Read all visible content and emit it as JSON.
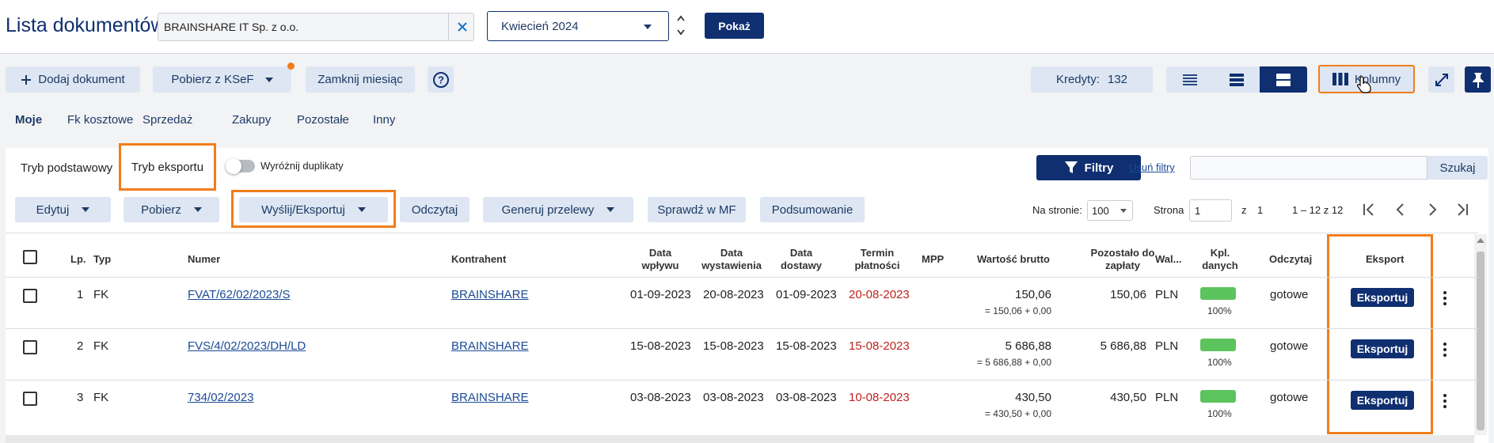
{
  "header": {
    "title": "Lista dokumentów",
    "company": "BRAINSHARE IT Sp. z o.o.",
    "period": "Kwiecień 2024",
    "show_label": "Pokaż"
  },
  "toolbar": {
    "add_document": "Dodaj dokument",
    "ksef": "Pobierz z KSeF",
    "close_month": "Zamknij miesiąc",
    "credits_label": "Kredyty:",
    "credits_value": "132",
    "columns": "Kolumny"
  },
  "tabs": [
    "Moje",
    "Fk kosztowe",
    "Sprzedaż",
    "Zakupy",
    "Pozostałe",
    "Inny"
  ],
  "modes": {
    "basic": "Tryb podstawowy",
    "export": "Tryb eksportu",
    "duplicates": "Wyróżnij duplikaty",
    "filters": "Filtry",
    "clear_filters": "Usuń filtry",
    "search": "Szukaj",
    "search_placeholder": ""
  },
  "actions": {
    "edit": "Edytuj",
    "download": "Pobierz",
    "send": "Wyślij/Eksportuj",
    "read": "Odczytaj",
    "transfers": "Generuj przelewy",
    "mf": "Sprawdź w MF",
    "summary": "Podsumowanie",
    "per_page_label": "Na stronie:",
    "per_page": "100",
    "page_label": "Strona",
    "page": "1",
    "of": "z",
    "total_pages": "1",
    "range": "1 – 12 z 12"
  },
  "columns": {
    "lp": "Lp.",
    "typ": "Typ",
    "numer": "Numer",
    "kontrahent": "Kontrahent",
    "data_wplywu": [
      "Data",
      "wpływu"
    ],
    "data_wyst": [
      "Data",
      "wystawienia"
    ],
    "data_dost": [
      "Data",
      "dostawy"
    ],
    "termin": [
      "Termin",
      "płatności"
    ],
    "mpp": "MPP",
    "brutto": "Wartość brutto",
    "pozostalo": [
      "Pozostało do",
      "zapłaty"
    ],
    "waluta": "Wal...",
    "kpl": [
      "Kpl.",
      "danych"
    ],
    "odczytaj": "Odczytaj",
    "eksport": "Eksport"
  },
  "rows": [
    {
      "lp": "1",
      "typ": "FK",
      "numer": "FVAT/62/02/2023/S",
      "kontrahent": "BRAINSHARE",
      "wplyw": "01-09-2023",
      "wyst": "20-08-2023",
      "dost": "01-09-2023",
      "termin": "20-08-2023",
      "brutto": "150,06",
      "brutto_sub": "= 150,06 + 0,00",
      "pozostalo": "150,06",
      "waluta": "PLN",
      "kpl": 1.0,
      "kpl_label": "100%",
      "odczyt": "gotowe",
      "eksport": "Eksportuj"
    },
    {
      "lp": "2",
      "typ": "FK",
      "numer": "FVS/4/02/2023/DH/LD",
      "kontrahent": "BRAINSHARE",
      "wplyw": "15-08-2023",
      "wyst": "15-08-2023",
      "dost": "15-08-2023",
      "termin": "15-08-2023",
      "brutto": "5 686,88",
      "brutto_sub": "= 5 686,88 + 0,00",
      "pozostalo": "5 686,88",
      "waluta": "PLN",
      "kpl": 1.0,
      "kpl_label": "100%",
      "odczyt": "gotowe",
      "eksport": "Eksportuj"
    },
    {
      "lp": "3",
      "typ": "FK",
      "numer": "734/02/2023",
      "kontrahent": "BRAINSHARE",
      "wplyw": "03-08-2023",
      "wyst": "03-08-2023",
      "dost": "03-08-2023",
      "termin": "10-08-2023",
      "brutto": "430,50",
      "brutto_sub": "= 430,50 + 0,00",
      "pozostalo": "430,50",
      "waluta": "PLN",
      "kpl": 1.0,
      "kpl_label": "100%",
      "odczyt": "gotowe",
      "eksport": "Eksportuj"
    }
  ]
}
